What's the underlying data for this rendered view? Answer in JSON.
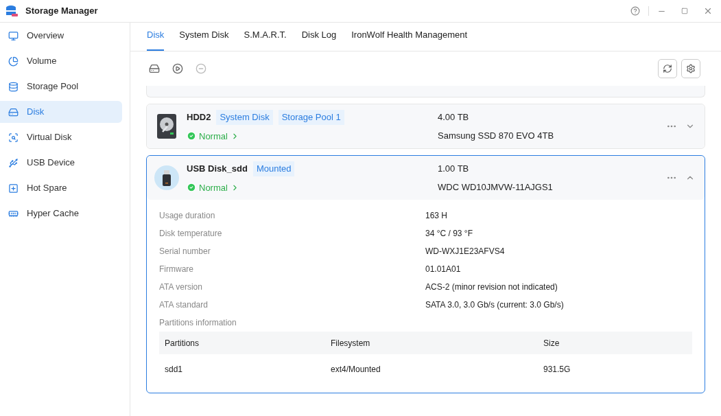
{
  "window": {
    "title": "Storage Manager"
  },
  "sidebar": {
    "items": [
      {
        "label": "Overview",
        "kind": "overview",
        "selected": false
      },
      {
        "label": "Volume",
        "kind": "volume",
        "selected": false
      },
      {
        "label": "Storage Pool",
        "kind": "pool",
        "selected": false
      },
      {
        "label": "Disk",
        "kind": "disk",
        "selected": true
      },
      {
        "label": "Virtual Disk",
        "kind": "virtual",
        "selected": false
      },
      {
        "label": "USB Device",
        "kind": "usb",
        "selected": false
      },
      {
        "label": "Hot Spare",
        "kind": "spare",
        "selected": false
      },
      {
        "label": "Hyper Cache",
        "kind": "cache",
        "selected": false
      }
    ]
  },
  "tabs": [
    {
      "label": "Disk",
      "selected": true
    },
    {
      "label": "System Disk",
      "selected": false
    },
    {
      "label": "S.M.A.R.T.",
      "selected": false
    },
    {
      "label": "Disk Log",
      "selected": false
    },
    {
      "label": "IronWolf Health Management",
      "selected": false
    }
  ],
  "disks": [
    {
      "kind": "hdd",
      "name": "HDD2",
      "tags": [
        "System Disk",
        "Storage Pool 1"
      ],
      "status": "Normal",
      "capacity": "4.00 TB",
      "model": "Samsung SSD 870 EVO 4TB",
      "expanded": false
    },
    {
      "kind": "usb",
      "name": "USB Disk_sdd",
      "tags": [
        "Mounted"
      ],
      "status": "Normal",
      "capacity": "1.00 TB",
      "model": "WDC WD10JMVW-11AJGS1",
      "expanded": true,
      "details": [
        {
          "label": "Usage duration",
          "value": "163 H"
        },
        {
          "label": "Disk temperature",
          "value": "34 °C / 93 °F"
        },
        {
          "label": "Serial number",
          "value": "WD-WXJ1E23AFVS4"
        },
        {
          "label": "Firmware",
          "value": "01.01A01"
        },
        {
          "label": "ATA version",
          "value": "ACS-2 (minor revision not indicated)"
        },
        {
          "label": "ATA standard",
          "value": "SATA 3.0, 3.0 Gb/s (current: 3.0 Gb/s)"
        }
      ],
      "partitions_label": "Partitions information",
      "partitions": {
        "columns": [
          "Partitions",
          "Filesystem",
          "Size"
        ],
        "rows": [
          [
            "sdd1",
            "ext4/Mounted",
            "931.5G"
          ]
        ]
      }
    }
  ]
}
